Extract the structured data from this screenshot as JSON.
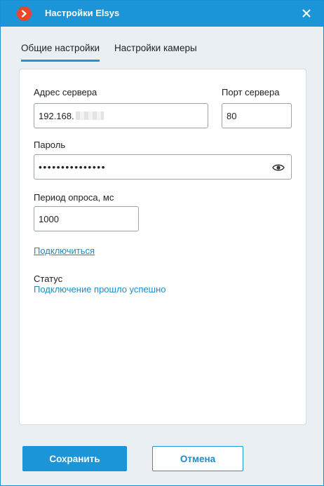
{
  "window": {
    "title": "Настройки Elsys"
  },
  "tabs": [
    {
      "label": "Общие настройки",
      "active": true
    },
    {
      "label": "Настройки камеры",
      "active": false
    }
  ],
  "form": {
    "server_address_label": "Адрес сервера",
    "server_address_value": "192.168.",
    "server_port_label": "Порт сервера",
    "server_port_value": "80",
    "password_label": "Пароль",
    "password_value": "•••••••••••••••",
    "poll_period_label": "Период опроса, мс",
    "poll_period_value": "1000",
    "connect_link": "Подключиться",
    "status_label": "Статус",
    "status_value": "Подключение прошло успешно"
  },
  "footer": {
    "save_label": "Сохранить",
    "cancel_label": "Отмена"
  },
  "colors": {
    "accent": "#1b95d8",
    "logo": "#e8452b",
    "link": "#1b8ccc"
  },
  "icons": [
    "app-logo-icon",
    "close-icon",
    "eye-icon"
  ]
}
